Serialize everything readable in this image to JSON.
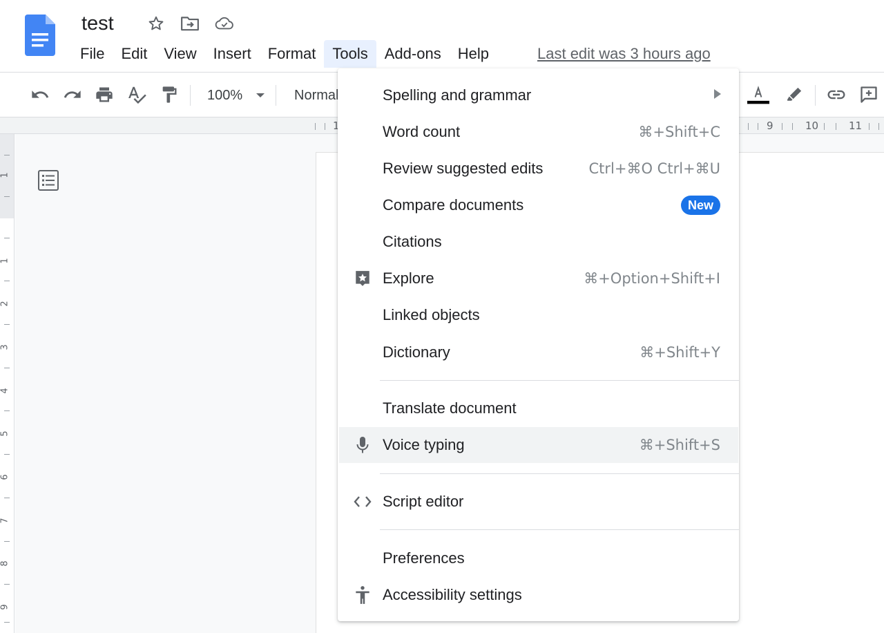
{
  "document": {
    "title": "test"
  },
  "menubar": {
    "items": [
      "File",
      "Edit",
      "View",
      "Insert",
      "Format",
      "Tools",
      "Add-ons",
      "Help"
    ],
    "active": "Tools",
    "last_edit": "Last edit was 3 hours ago"
  },
  "toolbar": {
    "zoom": "100%",
    "style": "Normal",
    "text_color": "#000000"
  },
  "ruler": {
    "top_numbers": [
      "1",
      "9",
      "10",
      "11"
    ],
    "left_numbers": [
      "1",
      "1",
      "2",
      "3",
      "4",
      "5",
      "6",
      "7",
      "8",
      "9"
    ]
  },
  "tools_menu": {
    "items": [
      {
        "label": "Spelling and grammar",
        "submenu": true
      },
      {
        "label": "Word count",
        "shortcut": "⌘+Shift+C"
      },
      {
        "label": "Review suggested edits",
        "shortcut": "Ctrl+⌘O Ctrl+⌘U"
      },
      {
        "label": "Compare documents",
        "badge": "New"
      },
      {
        "label": "Citations"
      },
      {
        "label": "Explore",
        "shortcut": "⌘+Option+Shift+I",
        "icon": "explore-icon"
      },
      {
        "label": "Linked objects"
      },
      {
        "label": "Dictionary",
        "shortcut": "⌘+Shift+Y"
      },
      {
        "label": "Translate document"
      },
      {
        "label": "Voice typing",
        "shortcut": "⌘+Shift+S",
        "icon": "microphone-icon",
        "highlighted": true
      },
      {
        "label": "Script editor",
        "icon": "code-icon"
      },
      {
        "label": "Preferences"
      },
      {
        "label": "Accessibility settings",
        "icon": "accessibility-icon"
      }
    ]
  },
  "colors": {
    "accent": "#1a73e8",
    "menu_active_bg": "#e8f0fe",
    "highlight_bg": "#f1f3f4",
    "doc_icon": "#4285f4"
  }
}
